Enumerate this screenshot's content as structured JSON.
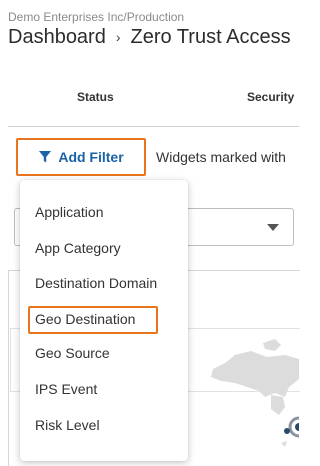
{
  "header": {
    "org_path": "Demo Enterprises Inc/Production",
    "breadcrumb": [
      "Dashboard",
      "Zero Trust Access"
    ],
    "separator": "›"
  },
  "tabs": [
    "Status",
    "Security"
  ],
  "filter": {
    "add_filter_label": "Add Filter",
    "widgets_note": "Widgets marked with",
    "accent_color": "#e8741e",
    "link_color": "#1a63a8"
  },
  "filter_menu": {
    "items": [
      "Application",
      "App Category",
      "Destination Domain",
      "Geo Destination",
      "Geo Source",
      "IPS Event",
      "Risk Level"
    ],
    "highlighted": "Geo Destination"
  },
  "icons": {
    "filter": "filter-funnel-icon",
    "select_caret": "caret-down-icon",
    "map": "world-map-icon"
  }
}
